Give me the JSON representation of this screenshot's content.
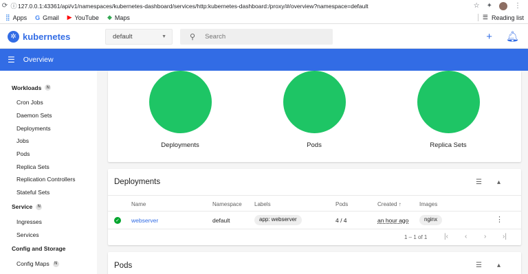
{
  "browser": {
    "url": "127.0.0.1:43361/api/v1/namespaces/kubernetes-dashboard/services/http:kubernetes-dashboard:/proxy/#/overview?namespace=default",
    "bookmarks": [
      {
        "label": "Apps",
        "icon": "apps-grid-icon"
      },
      {
        "label": "Gmail",
        "icon": "google-icon"
      },
      {
        "label": "YouTube",
        "icon": "youtube-icon"
      },
      {
        "label": "Maps",
        "icon": "maps-icon"
      }
    ],
    "reading_list": "Reading list"
  },
  "header": {
    "brand": "kubernetes",
    "namespace": "default",
    "search_placeholder": "Search"
  },
  "toolbar": {
    "title": "Overview"
  },
  "sidebar": {
    "workloads": {
      "label": "Workloads",
      "badge": "N",
      "items": [
        "Cron Jobs",
        "Daemon Sets",
        "Deployments",
        "Jobs",
        "Pods",
        "Replica Sets",
        "Replication Controllers",
        "Stateful Sets"
      ]
    },
    "service": {
      "label": "Service",
      "badge": "N",
      "items": [
        "Ingresses",
        "Services"
      ]
    },
    "config": {
      "label": "Config and Storage",
      "items": [
        "Config Maps"
      ],
      "config_maps_badge": "N"
    }
  },
  "workload_status": {
    "charts": [
      {
        "label": "Deployments",
        "color": "#1ec565"
      },
      {
        "label": "Pods",
        "color": "#1ec565"
      },
      {
        "label": "Replica Sets",
        "color": "#1ec565"
      }
    ]
  },
  "deployments": {
    "title": "Deployments",
    "columns": [
      "Name",
      "Namespace",
      "Labels",
      "Pods",
      "Created",
      "Images"
    ],
    "sort_indicator": "↑",
    "rows": [
      {
        "name": "webserver",
        "namespace": "default",
        "labels": "app: webserver",
        "pods": "4 / 4",
        "created": "an hour ago",
        "images": "nginx"
      }
    ],
    "pagination": "1 – 1 of 1"
  },
  "pods": {
    "title": "Pods"
  },
  "colors": {
    "accent": "#326ce5",
    "success": "#1ec565"
  }
}
